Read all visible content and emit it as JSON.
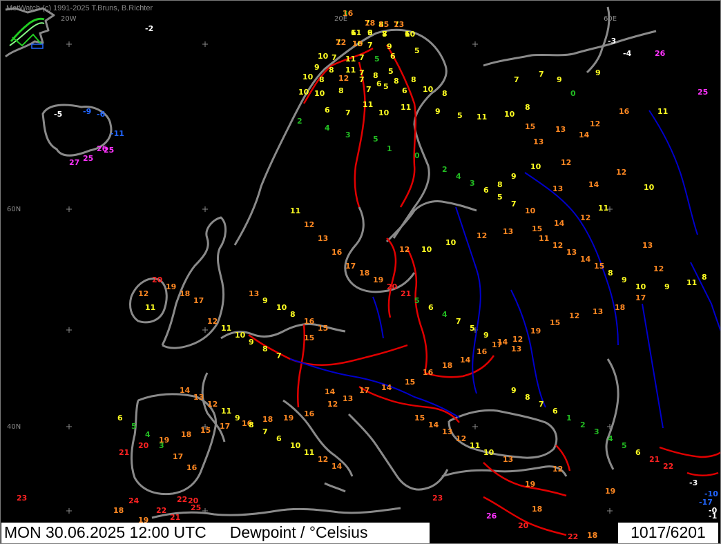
{
  "app": {
    "credit": "MetWatch  (c) 1991-2025 T.Bruns, B.Richter"
  },
  "grid_labels": {
    "lon_20w": "20W",
    "lon_20e": "20E",
    "lon_60e": "60E",
    "lat_60n": "60N",
    "lat_40n": "40N"
  },
  "status": {
    "datetime": "MON 30.06.2025 12:00 UTC",
    "parameter": "Dewpoint / °Celsius",
    "frame_counter": "1017/6201"
  },
  "colors": {
    "background": "#000000",
    "coastline": "#8a8a8a",
    "border": "#e00000",
    "river": "#0000cc",
    "lt0": "#ffffff",
    "r0_6": "#22bb22",
    "r6_12": "#ffff22",
    "r12_20": "#ff8822",
    "r20_25": "#ff2222",
    "ge25": "#ff33ff",
    "neg_blue": "#2266ff"
  },
  "observations": [
    {
      "v": "3",
      "c": "g"
    },
    {
      "v": "7",
      "c": "y"
    },
    {
      "v": "8",
      "c": "y"
    },
    {
      "v": "7",
      "c": "y"
    },
    {
      "v": "6",
      "c": "y"
    },
    {
      "v": "6",
      "c": "y"
    },
    {
      "v": "8",
      "c": "y"
    },
    {
      "v": "6",
      "c": "y"
    },
    {
      "v": "7",
      "c": "y"
    },
    {
      "v": "10",
      "c": "y"
    },
    {
      "v": "7",
      "c": "y"
    },
    {
      "v": "9",
      "c": "y"
    },
    {
      "v": "10",
      "c": "y"
    },
    {
      "v": "7",
      "c": "y"
    },
    {
      "v": "11",
      "c": "y"
    },
    {
      "v": "7",
      "c": "y"
    },
    {
      "v": "5",
      "c": "g"
    },
    {
      "v": "6",
      "c": "y"
    },
    {
      "v": "5",
      "c": "y"
    },
    {
      "v": "9",
      "c": "y"
    },
    {
      "v": "8",
      "c": "y"
    },
    {
      "v": "11",
      "c": "y"
    },
    {
      "v": "7",
      "c": "y"
    },
    {
      "v": "8",
      "c": "y"
    },
    {
      "v": "5",
      "c": "y"
    },
    {
      "v": "10",
      "c": "y"
    },
    {
      "v": "8",
      "c": "y"
    },
    {
      "v": "12",
      "c": "o"
    },
    {
      "v": "7",
      "c": "y"
    },
    {
      "v": "6",
      "c": "y"
    },
    {
      "v": "8",
      "c": "y"
    },
    {
      "v": "8",
      "c": "y"
    },
    {
      "v": "10",
      "c": "y"
    },
    {
      "v": "10",
      "c": "y"
    },
    {
      "v": "8",
      "c": "y"
    },
    {
      "v": "7",
      "c": "y"
    },
    {
      "v": "5",
      "c": "y"
    },
    {
      "v": "6",
      "c": "y"
    },
    {
      "v": "10",
      "c": "y"
    },
    {
      "v": "8",
      "c": "y"
    },
    {
      "v": "6",
      "c": "y"
    },
    {
      "v": "7",
      "c": "y"
    },
    {
      "v": "11",
      "c": "y"
    },
    {
      "v": "10",
      "c": "y"
    },
    {
      "v": "11",
      "c": "y"
    },
    {
      "v": "9",
      "c": "y"
    },
    {
      "v": "5",
      "c": "y"
    },
    {
      "v": "11",
      "c": "y"
    },
    {
      "v": "10",
      "c": "y"
    },
    {
      "v": "8",
      "c": "y"
    },
    {
      "v": "7",
      "c": "y"
    },
    {
      "v": "9",
      "c": "y"
    },
    {
      "v": "0",
      "c": "g"
    },
    {
      "v": "9",
      "c": "y"
    },
    {
      "v": "7",
      "c": "y"
    },
    {
      "v": "15",
      "c": "o"
    },
    {
      "v": "13",
      "c": "o"
    },
    {
      "v": "14",
      "c": "o"
    },
    {
      "v": "12",
      "c": "o"
    },
    {
      "v": "16",
      "c": "o"
    },
    {
      "v": "11",
      "c": "y"
    },
    {
      "v": "13",
      "c": "o"
    },
    {
      "v": "12",
      "c": "o"
    },
    {
      "v": "10",
      "c": "y"
    },
    {
      "v": "9",
      "c": "y"
    },
    {
      "v": "8",
      "c": "y"
    },
    {
      "v": "13",
      "c": "o"
    },
    {
      "v": "14",
      "c": "o"
    },
    {
      "v": "12",
      "c": "o"
    },
    {
      "v": "10",
      "c": "y"
    },
    {
      "v": "11",
      "c": "y"
    },
    {
      "v": "12",
      "c": "o"
    },
    {
      "v": "14",
      "c": "o"
    },
    {
      "v": "15",
      "c": "o"
    },
    {
      "v": "13",
      "c": "o"
    },
    {
      "v": "12",
      "c": "o"
    },
    {
      "v": "10",
      "c": "y"
    },
    {
      "v": "10",
      "c": "y"
    },
    {
      "v": "12",
      "c": "o"
    },
    {
      "v": "13",
      "c": "o"
    },
    {
      "v": "12",
      "c": "o"
    },
    {
      "v": "9",
      "c": "y"
    },
    {
      "v": "11",
      "c": "y"
    },
    {
      "v": "8",
      "c": "y"
    },
    {
      "v": "17",
      "c": "o"
    },
    {
      "v": "18",
      "c": "o"
    },
    {
      "v": "13",
      "c": "o"
    },
    {
      "v": "12",
      "c": "o"
    },
    {
      "v": "15",
      "c": "o"
    },
    {
      "v": "19",
      "c": "o"
    },
    {
      "v": "12",
      "c": "o"
    },
    {
      "v": "17",
      "c": "o"
    },
    {
      "v": "16",
      "c": "o"
    },
    {
      "v": "14",
      "c": "o"
    },
    {
      "v": "18",
      "c": "o"
    },
    {
      "v": "16",
      "c": "o"
    },
    {
      "v": "15",
      "c": "o"
    },
    {
      "v": "14",
      "c": "o"
    },
    {
      "v": "17",
      "c": "o"
    },
    {
      "v": "13",
      "c": "o"
    },
    {
      "v": "12",
      "c": "o"
    },
    {
      "v": "16",
      "c": "o"
    },
    {
      "v": "19",
      "c": "o"
    },
    {
      "v": "18",
      "c": "o"
    },
    {
      "v": "16",
      "c": "o"
    },
    {
      "v": "17",
      "c": "o"
    },
    {
      "v": "15",
      "c": "o"
    },
    {
      "v": "18",
      "c": "o"
    },
    {
      "v": "19",
      "c": "o"
    },
    {
      "v": "20",
      "c": "r"
    },
    {
      "v": "21",
      "c": "r"
    },
    {
      "v": "23",
      "c": "r"
    },
    {
      "v": "24",
      "c": "r"
    },
    {
      "v": "18",
      "c": "o"
    },
    {
      "v": "19",
      "c": "o"
    },
    {
      "v": "22",
      "c": "r"
    },
    {
      "v": "25",
      "c": "r"
    },
    {
      "v": "21",
      "c": "r"
    },
    {
      "v": "22",
      "c": "r"
    },
    {
      "v": "20",
      "c": "r"
    },
    {
      "v": "14",
      "c": "o"
    },
    {
      "v": "15",
      "c": "o"
    },
    {
      "v": "13",
      "c": "o"
    },
    {
      "v": "12",
      "c": "o"
    },
    {
      "v": "19",
      "c": "o"
    },
    {
      "v": "26",
      "c": "m"
    },
    {
      "v": "18",
      "c": "o"
    },
    {
      "v": "20",
      "c": "r"
    },
    {
      "v": "19",
      "c": "o"
    },
    {
      "v": "23",
      "c": "r"
    },
    {
      "v": "22",
      "c": "r"
    },
    {
      "v": "18",
      "c": "o"
    },
    {
      "v": "-3",
      "c": "w"
    },
    {
      "v": "-10",
      "c": "b"
    },
    {
      "v": "-17",
      "c": "b"
    },
    {
      "v": "-0",
      "c": "w"
    },
    {
      "v": "-1",
      "c": "w"
    },
    {
      "v": "-2",
      "c": "w"
    },
    {
      "v": "-3",
      "c": "w"
    },
    {
      "v": "-4",
      "c": "w"
    },
    {
      "v": "-5",
      "c": "w"
    },
    {
      "v": "-9",
      "c": "b"
    },
    {
      "v": "-6",
      "c": "b"
    },
    {
      "v": "-11",
      "c": "b"
    },
    {
      "v": "26",
      "c": "m"
    },
    {
      "v": "27",
      "c": "m"
    },
    {
      "v": "25",
      "c": "m"
    },
    {
      "v": "25",
      "c": "m"
    },
    {
      "v": "26",
      "c": "m"
    },
    {
      "v": "25",
      "c": "m"
    },
    {
      "v": "2",
      "c": "g"
    },
    {
      "v": "4",
      "c": "g"
    },
    {
      "v": "3",
      "c": "g"
    },
    {
      "v": "5",
      "c": "g"
    },
    {
      "v": "1",
      "c": "g"
    },
    {
      "v": "0",
      "c": "g"
    },
    {
      "v": "2",
      "c": "g"
    },
    {
      "v": "4",
      "c": "g"
    },
    {
      "v": "3",
      "c": "g"
    },
    {
      "v": "6",
      "c": "y"
    },
    {
      "v": "5",
      "c": "y"
    },
    {
      "v": "7",
      "c": "y"
    },
    {
      "v": "10",
      "c": "o"
    },
    {
      "v": "11",
      "c": "o"
    },
    {
      "v": "12",
      "c": "o"
    },
    {
      "v": "13",
      "c": "o"
    },
    {
      "v": "14",
      "c": "o"
    },
    {
      "v": "15",
      "c": "o"
    },
    {
      "v": "8",
      "c": "y"
    },
    {
      "v": "9",
      "c": "y"
    },
    {
      "v": "10",
      "c": "y"
    },
    {
      "v": "11",
      "c": "y"
    },
    {
      "v": "12",
      "c": "o"
    },
    {
      "v": "13",
      "c": "o"
    },
    {
      "v": "16",
      "c": "o"
    },
    {
      "v": "17",
      "c": "o"
    },
    {
      "v": "18",
      "c": "o"
    },
    {
      "v": "19",
      "c": "o"
    },
    {
      "v": "20",
      "c": "r"
    },
    {
      "v": "21",
      "c": "r"
    },
    {
      "v": "5",
      "c": "g"
    },
    {
      "v": "6",
      "c": "y"
    },
    {
      "v": "4",
      "c": "g"
    },
    {
      "v": "7",
      "c": "y"
    },
    {
      "v": "5",
      "c": "y"
    },
    {
      "v": "9",
      "c": "y"
    },
    {
      "v": "14",
      "c": "o"
    },
    {
      "v": "13",
      "c": "o"
    },
    {
      "v": "12",
      "c": "o"
    },
    {
      "v": "11",
      "c": "y"
    },
    {
      "v": "10",
      "c": "y"
    },
    {
      "v": "9",
      "c": "y"
    },
    {
      "v": "8",
      "c": "y"
    },
    {
      "v": "7",
      "c": "y"
    },
    {
      "v": "6",
      "c": "y"
    },
    {
      "v": "5",
      "c": "g"
    },
    {
      "v": "4",
      "c": "g"
    },
    {
      "v": "3",
      "c": "g"
    },
    {
      "v": "17",
      "c": "o"
    },
    {
      "v": "16",
      "c": "o"
    },
    {
      "v": "15",
      "c": "o"
    },
    {
      "v": "14",
      "c": "o"
    },
    {
      "v": "13",
      "c": "o"
    },
    {
      "v": "12",
      "c": "o"
    },
    {
      "v": "11",
      "c": "y"
    },
    {
      "v": "10",
      "c": "y"
    },
    {
      "v": "9",
      "c": "y"
    },
    {
      "v": "8",
      "c": "y"
    },
    {
      "v": "7",
      "c": "y"
    },
    {
      "v": "6",
      "c": "y"
    },
    {
      "v": "1",
      "c": "g"
    },
    {
      "v": "2",
      "c": "g"
    },
    {
      "v": "3",
      "c": "g"
    },
    {
      "v": "4",
      "c": "g"
    },
    {
      "v": "5",
      "c": "g"
    },
    {
      "v": "6",
      "c": "y"
    },
    {
      "v": "21",
      "c": "r"
    },
    {
      "v": "22",
      "c": "r"
    },
    {
      "v": "20",
      "c": "r"
    },
    {
      "v": "19",
      "c": "o"
    },
    {
      "v": "18",
      "c": "o"
    },
    {
      "v": "17",
      "c": "o"
    },
    {
      "v": "12",
      "c": "o"
    },
    {
      "v": "11",
      "c": "y"
    },
    {
      "v": "13",
      "c": "o"
    },
    {
      "v": "9",
      "c": "y"
    },
    {
      "v": "10",
      "c": "y"
    },
    {
      "v": "8",
      "c": "y"
    },
    {
      "v": "16",
      "c": "o"
    },
    {
      "v": "15",
      "c": "o"
    },
    {
      "v": "14",
      "c": "o"
    },
    {
      "v": "13",
      "c": "o"
    },
    {
      "v": "12",
      "c": "o"
    },
    {
      "v": "11",
      "c": "y"
    },
    {
      "v": "9",
      "c": "y"
    },
    {
      "v": "8",
      "c": "y"
    },
    {
      "v": "7",
      "c": "y"
    },
    {
      "v": "6",
      "c": "y"
    },
    {
      "v": "10",
      "c": "y"
    },
    {
      "v": "11",
      "c": "y"
    },
    {
      "v": "12",
      "c": "o"
    },
    {
      "v": "14",
      "c": "o"
    },
    {
      "v": "16",
      "c": "o"
    },
    {
      "v": "18",
      "c": "o"
    },
    {
      "v": "15",
      "c": "o"
    },
    {
      "v": "13",
      "c": "o"
    },
    {
      "v": "11",
      "c": "y"
    },
    {
      "v": "9",
      "c": "y"
    },
    {
      "v": "7",
      "c": "y"
    },
    {
      "v": "10",
      "c": "y"
    },
    {
      "v": "12",
      "c": "o"
    },
    {
      "v": "13",
      "c": "o"
    }
  ]
}
